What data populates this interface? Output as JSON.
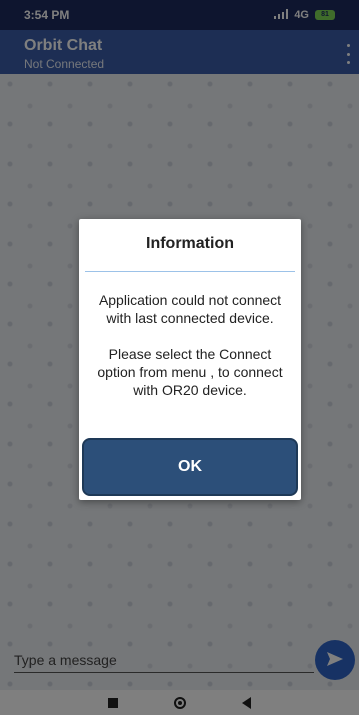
{
  "status_bar": {
    "time": "3:54 PM",
    "signal": "4G",
    "battery": "81"
  },
  "app_bar": {
    "title": "Orbit Chat",
    "subtitle": "Not Connected"
  },
  "composer": {
    "placeholder": "Type a message"
  },
  "dialog": {
    "title": "Information",
    "message": "Application could not connect with last connected device.\n\nPlease select the Connect option from menu , to connect with OR20 device.",
    "ok_label": "OK"
  },
  "colors": {
    "status_bar": "#1c2a5e",
    "app_bar": "#3a5da8",
    "ok_button": "#2c4f79",
    "send_button": "#2f65c8"
  }
}
